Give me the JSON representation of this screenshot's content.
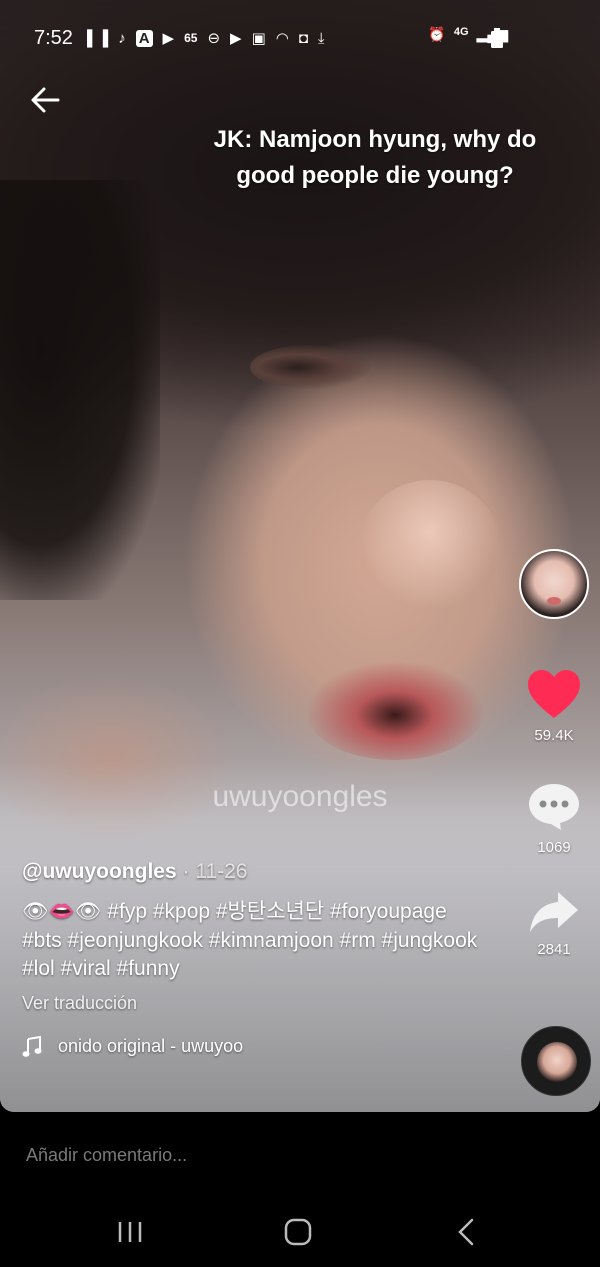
{
  "status_bar": {
    "time": "7:52",
    "temp": "65",
    "network": "4G",
    "left_icons": [
      "bts-icon",
      "tiktok-icon",
      "a-icon",
      "youtube-icon",
      "weather-icon",
      "dnd-icon",
      "youtube-icon",
      "gallery-icon",
      "wifi-icon",
      "app-icon",
      "download-icon"
    ],
    "right_icons": [
      "alarm-icon",
      "signal-icon",
      "battery-icon"
    ]
  },
  "video": {
    "caption": "JK: Namjoon hyung, why do good people die young?",
    "watermark": "uwuyoongles"
  },
  "actions": {
    "likes": "59.4K",
    "comments": "1069",
    "shares": "2841"
  },
  "post": {
    "username": "@uwuyoongles",
    "date": "· 11-26",
    "description": "👁👄👁 #fyp #kpop #방탄소년단 #foryoupage #bts #jeonjungkook #kimnamjoon #rm #jungkook #lol #viral #funny",
    "translate_label": "Ver traducción",
    "sound": "onido original - uwuyoo"
  },
  "comment_input": {
    "placeholder": "Añadir comentario..."
  },
  "colors": {
    "like_red": "#fe2c55",
    "background": "#000000"
  }
}
